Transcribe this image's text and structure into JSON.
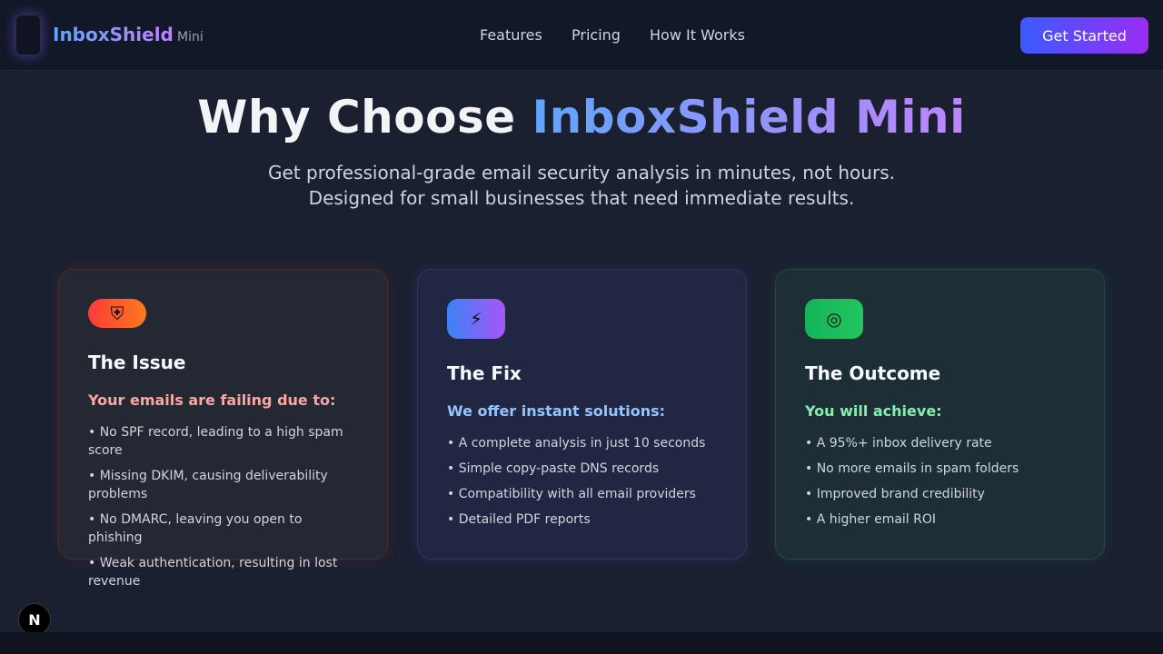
{
  "nav": {
    "brand": "InboxShield",
    "brand_sub": "Mini",
    "links": [
      "Features",
      "Pricing",
      "How It Works"
    ],
    "cta_label": "Get Started"
  },
  "hero": {
    "title_plain": "Why Choose ",
    "title_highlight": "InboxShield Mini",
    "subtitle_line1": "Get professional-grade email security analysis in minutes, not hours.",
    "subtitle_line2": "Designed for small businesses that need immediate results."
  },
  "cards": [
    {
      "icon": "shield-alert-icon",
      "icon_glyph": "⛨",
      "title": "The Issue",
      "lead": "Your emails are failing due to:",
      "items": [
        "• No SPF record, leading to a high spam score",
        "• Missing DKIM, causing deliverability problems",
        "• No DMARC, leaving you open to phishing",
        "• Weak authentication, resulting in lost revenue"
      ]
    },
    {
      "icon": "lightning-icon",
      "icon_glyph": "⚡",
      "title": "The Fix",
      "lead": "We offer instant solutions:",
      "items": [
        "• A complete analysis in just 10 seconds",
        "• Simple copy-paste DNS records",
        "• Compatibility with all email providers",
        "• Detailed PDF reports"
      ]
    },
    {
      "icon": "target-icon",
      "icon_glyph": "◎",
      "title": "The Outcome",
      "lead": "You will achieve:",
      "items": [
        "• A 95%+ inbox delivery rate",
        "• No more emails in spam folders",
        "• Improved brand credibility",
        "• A higher email ROI"
      ]
    }
  ],
  "badge": "N",
  "colors": {
    "accent_start": "#3b5bff",
    "accent_end": "#9a2cf2",
    "issue": "#ef4444",
    "fix": "#6366f1",
    "outcome": "#22c55e"
  }
}
